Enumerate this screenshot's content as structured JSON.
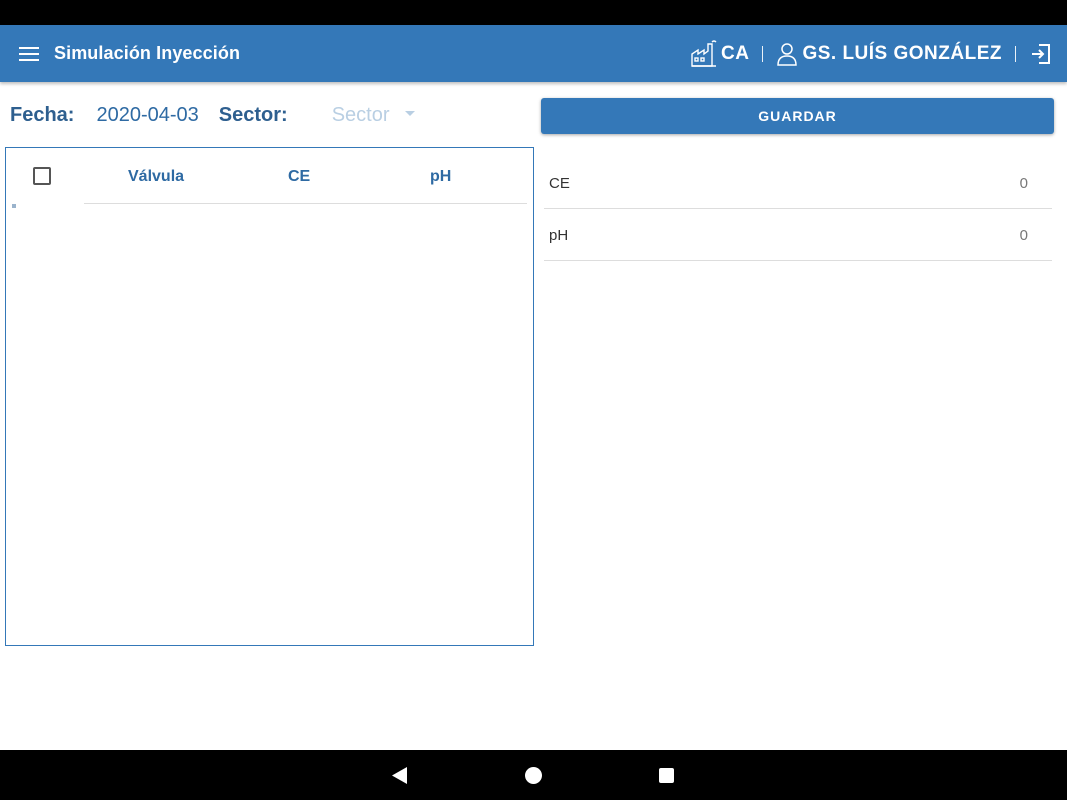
{
  "header": {
    "title": "Simulación Inyección",
    "site_code": "CA",
    "user_name": "GS. LUÍS GONZÁLEZ"
  },
  "filters": {
    "date_label": "Fecha:",
    "date_value": "2020-04-03",
    "sector_label": "Sector:",
    "sector_placeholder": "Sector"
  },
  "actions": {
    "save_label": "GUARDAR"
  },
  "table": {
    "columns": [
      "Válvula",
      "CE",
      "pH"
    ],
    "rows": []
  },
  "summary": [
    {
      "label": "CE",
      "value": "0"
    },
    {
      "label": "pH",
      "value": "0"
    }
  ],
  "icons": {
    "menu": "menu-icon",
    "site": "factory-icon",
    "user": "user-icon",
    "logout": "logout-icon"
  },
  "colors": {
    "primary": "#3478b8",
    "label": "#2e5f8f",
    "placeholder": "#b9cfe3"
  }
}
